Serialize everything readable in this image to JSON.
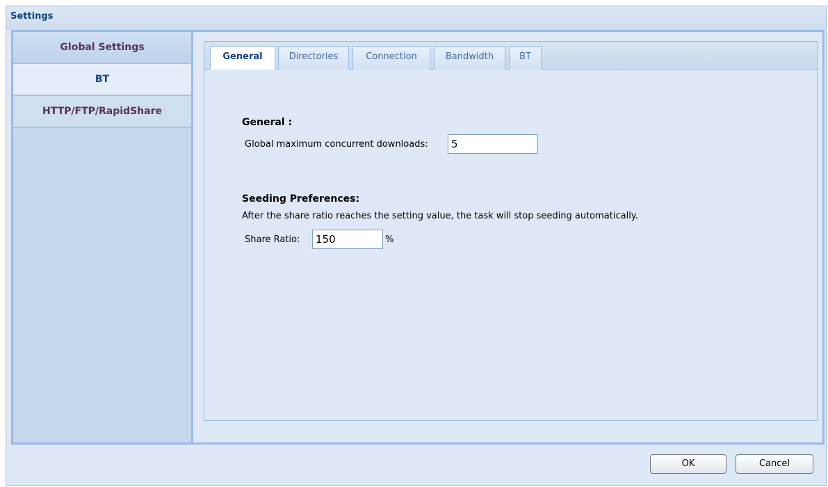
{
  "window": {
    "title": "Settings"
  },
  "sidebar": {
    "items": [
      {
        "label": "Global Settings"
      },
      {
        "label": "BT"
      },
      {
        "label": "HTTP/FTP/RapidShare"
      }
    ]
  },
  "tabs": [
    {
      "label": "General",
      "active": true
    },
    {
      "label": "Directories"
    },
    {
      "label": "Connection"
    },
    {
      "label": "Bandwidth"
    },
    {
      "label": "BT"
    }
  ],
  "general": {
    "heading": "General :",
    "max_downloads_label": "Global maximum concurrent downloads:",
    "max_downloads_value": "5"
  },
  "seeding": {
    "heading": "Seeding Preferences:",
    "description": "After the share ratio reaches the setting value, the task will stop seeding automatically.",
    "share_ratio_label": "Share Ratio:",
    "share_ratio_value": "150",
    "share_ratio_unit": "%"
  },
  "buttons": {
    "ok": "OK",
    "cancel": "Cancel"
  }
}
